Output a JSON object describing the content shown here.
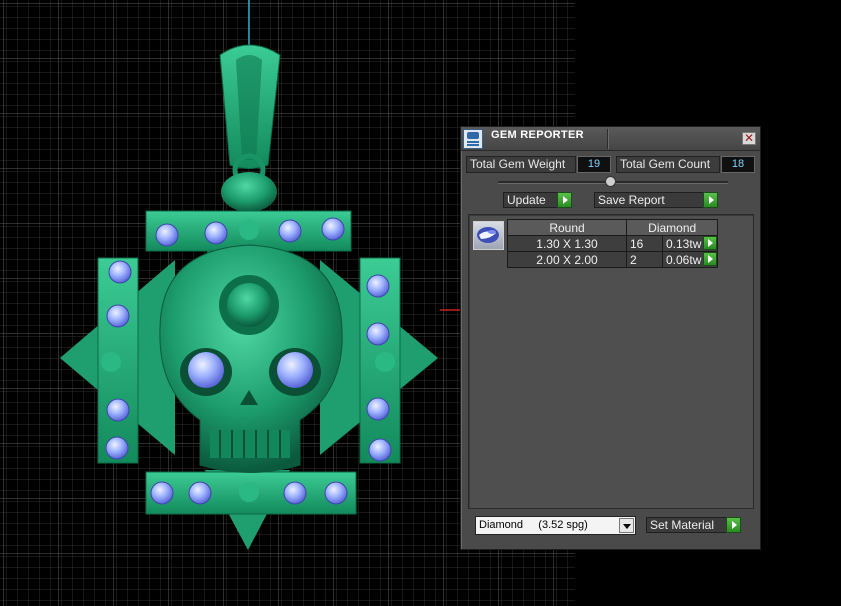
{
  "panel": {
    "title": "GEM REPORTER",
    "total_gem_weight_label": "Total Gem Weight",
    "total_gem_weight_value": "19",
    "total_gem_count_label": "Total Gem Count",
    "total_gem_count_value": "18",
    "update_label": "Update",
    "save_report_label": "Save Report",
    "set_material_label": "Set Material",
    "material_selected": "Diamond     (3.52 spg)"
  },
  "report": {
    "shape_header": "Round",
    "material_header": "Diamond",
    "rows": [
      {
        "size": "1.30 X 1.30",
        "count": "16",
        "weight": "0.13tw"
      },
      {
        "size": "2.00 X 2.00",
        "count": "2",
        "weight": "0.06tw"
      }
    ]
  },
  "colors": {
    "model_green": "#1f9e70",
    "gem_blue": "#8ea8ff",
    "accent_green": "#3cb030",
    "value_cyan": "#7fd3ff"
  }
}
